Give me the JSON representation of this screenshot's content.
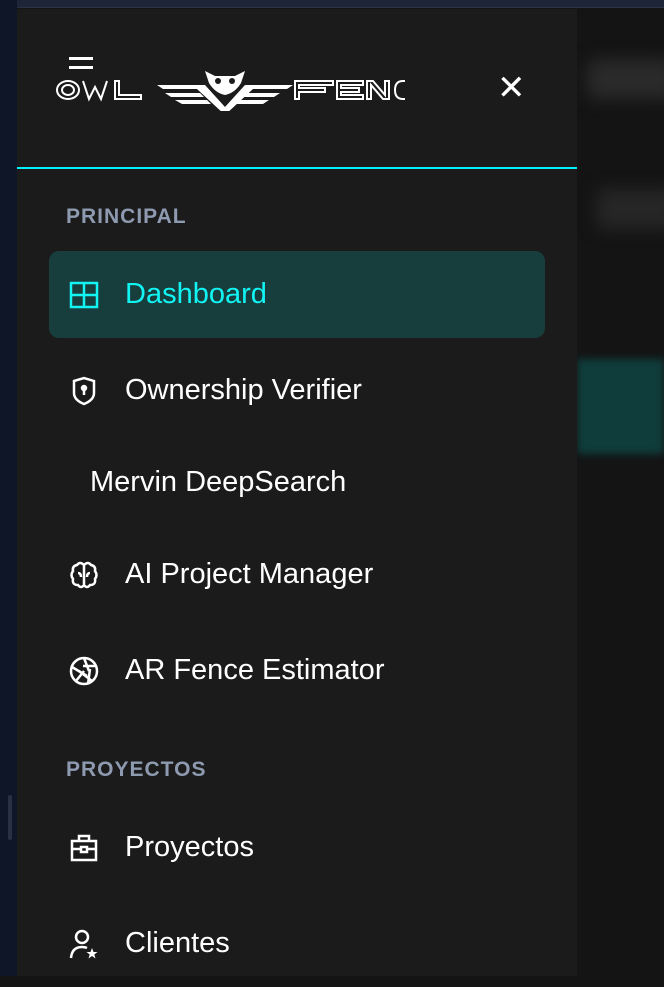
{
  "brand": {
    "name": "OWL FENC",
    "left": "OWL",
    "right": "FENC"
  },
  "sections": [
    {
      "label": "PRINCIPAL"
    },
    {
      "label": "PROYECTOS"
    }
  ],
  "items": [
    {
      "label": "Dashboard",
      "icon": "grid-icon",
      "active": true
    },
    {
      "label": "Ownership Verifier",
      "icon": "shield-lock-icon"
    },
    {
      "label": "Mervin DeepSearch",
      "icon": null
    },
    {
      "label": "AI Project Manager",
      "icon": "brain-icon"
    },
    {
      "label": "AR Fence Estimator",
      "icon": "aperture-icon"
    },
    {
      "label": "Proyectos",
      "icon": "briefcase-icon"
    },
    {
      "label": "Clientes",
      "icon": "user-star-icon"
    }
  ],
  "colors": {
    "accent": "#00f0ff",
    "active_bg": "#173e3c",
    "sidebar_bg": "#1b1b1b",
    "section": "#8e9ab0"
  }
}
